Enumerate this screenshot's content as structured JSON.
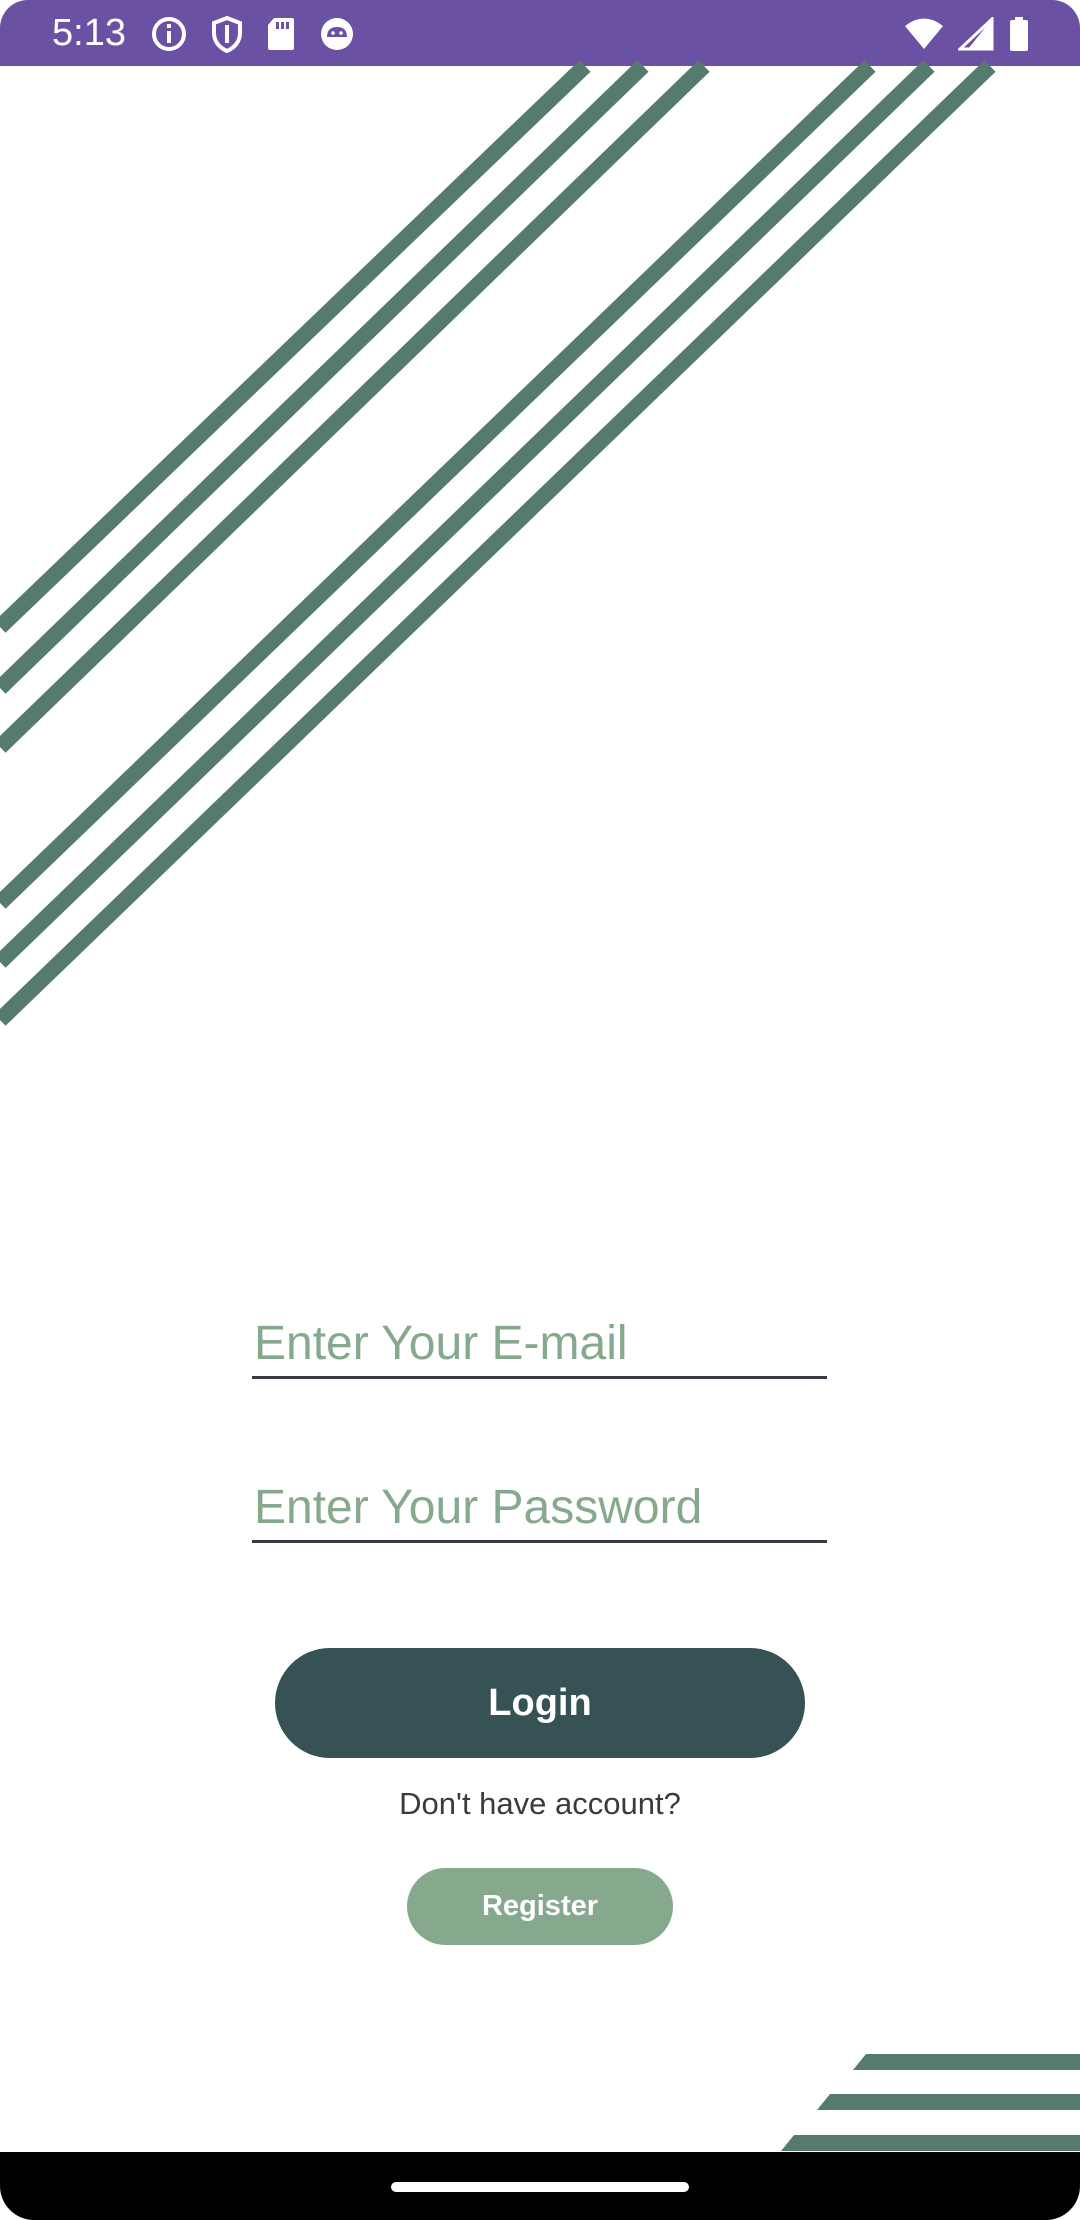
{
  "status_bar": {
    "time": "5:13",
    "left_icons": [
      "info-icon",
      "shield-icon",
      "sd-card-icon",
      "android-debug-icon"
    ],
    "right_icons": [
      "wifi-icon",
      "cell-signal-icon",
      "battery-icon"
    ],
    "color": "#6a51a3"
  },
  "login_form": {
    "email_placeholder": "Enter Your E-mail",
    "password_placeholder": "Enter Your Password",
    "login_label": "Login",
    "no_account_text": "Don't have account?",
    "register_label": "Register"
  },
  "colors": {
    "accent_green": "#86a98d",
    "stripe_green": "#547b6c",
    "login_button": "#375254"
  }
}
